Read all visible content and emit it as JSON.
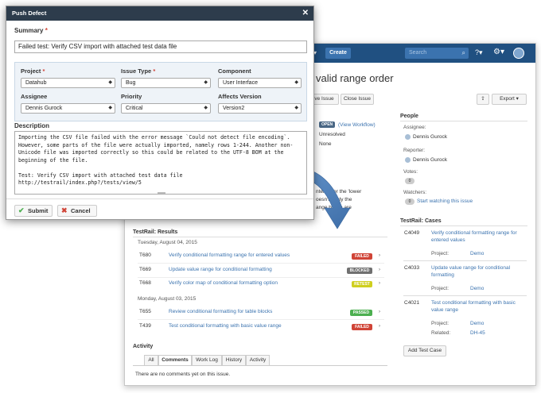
{
  "jira": {
    "create_label": "Create",
    "search_placeholder": "Search",
    "issue_title": "valid range order",
    "btn_resolve": "ve Issue",
    "btn_close": "Close Issue",
    "btn_export": "Export",
    "status": {
      "lozenge": "OPEN",
      "workflow_link": "(View Workflow)",
      "resolution": "Unresolved",
      "fix_version": "None"
    },
    "description_fragment": [
      "ntered for the 'lower",
      "oesn't apply the",
      "ange bytion are"
    ],
    "people": {
      "title": "People",
      "assignee_label": "Assignee:",
      "assignee": "Dennis Gurock",
      "reporter_label": "Reporter:",
      "reporter": "Dennis Gurock",
      "votes_label": "Votes:",
      "votes": "0",
      "watchers_label": "Watchers:",
      "watchers": "0",
      "watch_link": "Start watching this issue"
    },
    "results": {
      "title": "TestRail: Results",
      "groups": [
        {
          "date": "Tuesday, August 04, 2015",
          "rows": [
            {
              "id": "T680",
              "title": "Verify conditional formatting range for entered values",
              "status": "FAILED",
              "color": "#d04437"
            },
            {
              "id": "T669",
              "title": "Update value range for conditional formatting",
              "status": "BLOCKED",
              "color": "#707070"
            },
            {
              "id": "T668",
              "title": "Verify color map of conditional formatting option",
              "status": "RETEST",
              "color": "#cfcf1f"
            }
          ]
        },
        {
          "date": "Monday, August 03, 2015",
          "rows": [
            {
              "id": "T655",
              "title": "Review conditional formatting for table blocks",
              "status": "PASSED",
              "color": "#4caf50"
            },
            {
              "id": "T439",
              "title": "Test conditional formatting with basic value range",
              "status": "FAILED",
              "color": "#d04437"
            }
          ]
        }
      ]
    },
    "cases": {
      "title": "TestRail: Cases",
      "items": [
        {
          "id": "C4049",
          "title": [
            "Verify conditional formatting range for",
            "entered values"
          ],
          "project_label": "Project:",
          "project": "Demo"
        },
        {
          "id": "C4033",
          "title": [
            "Update value range for conditional",
            "formatting"
          ],
          "project_label": "Project:",
          "project": "Demo"
        },
        {
          "id": "C4021",
          "title": [
            "Test conditional formatting with basic",
            "value range"
          ],
          "project_label": "Project:",
          "project": "Demo",
          "related_label": "Related:",
          "related": "DH-45"
        }
      ],
      "add_button": "Add Test Case"
    },
    "activity": {
      "title": "Activity",
      "tabs": [
        "All",
        "Comments",
        "Work Log",
        "History",
        "Activity"
      ],
      "empty": "There are no comments yet on this issue."
    }
  },
  "modal": {
    "title": "Push Defect",
    "summary_label": "Summary",
    "summary_value": "Failed test: Verify CSV import with attached test data file",
    "project_label": "Project",
    "project_value": "Datahub",
    "issue_type_label": "Issue Type",
    "issue_type_value": "Bug",
    "component_label": "Component",
    "component_value": "User Interface",
    "assignee_label": "Assignee",
    "assignee_value": "Dennis Gurock",
    "priority_label": "Priority",
    "priority_value": "Critical",
    "affects_label": "Affects Version",
    "affects_value": "Version2",
    "description_label": "Description",
    "description_value": "Importing the CSV file failed with the error message `Could not detect file encoding`. However, some parts of the file were actually imported, namely rows 1-244. Another non-Unicode file was imported correctly so this could be related to the UTF-8 BOM at the beginning of the file.\n\nTest: Verify CSV import with attached test data file\nhttp://testrail/index.php?/tests/view/5",
    "submit_label": "Submit",
    "cancel_label": "Cancel"
  },
  "colors": {
    "topbar": "#205081",
    "modal_header": "#2d3c4c",
    "link": "#3b73af",
    "arrow": "#4f7fb5",
    "failed": "#d04437",
    "passed": "#4caf50"
  }
}
